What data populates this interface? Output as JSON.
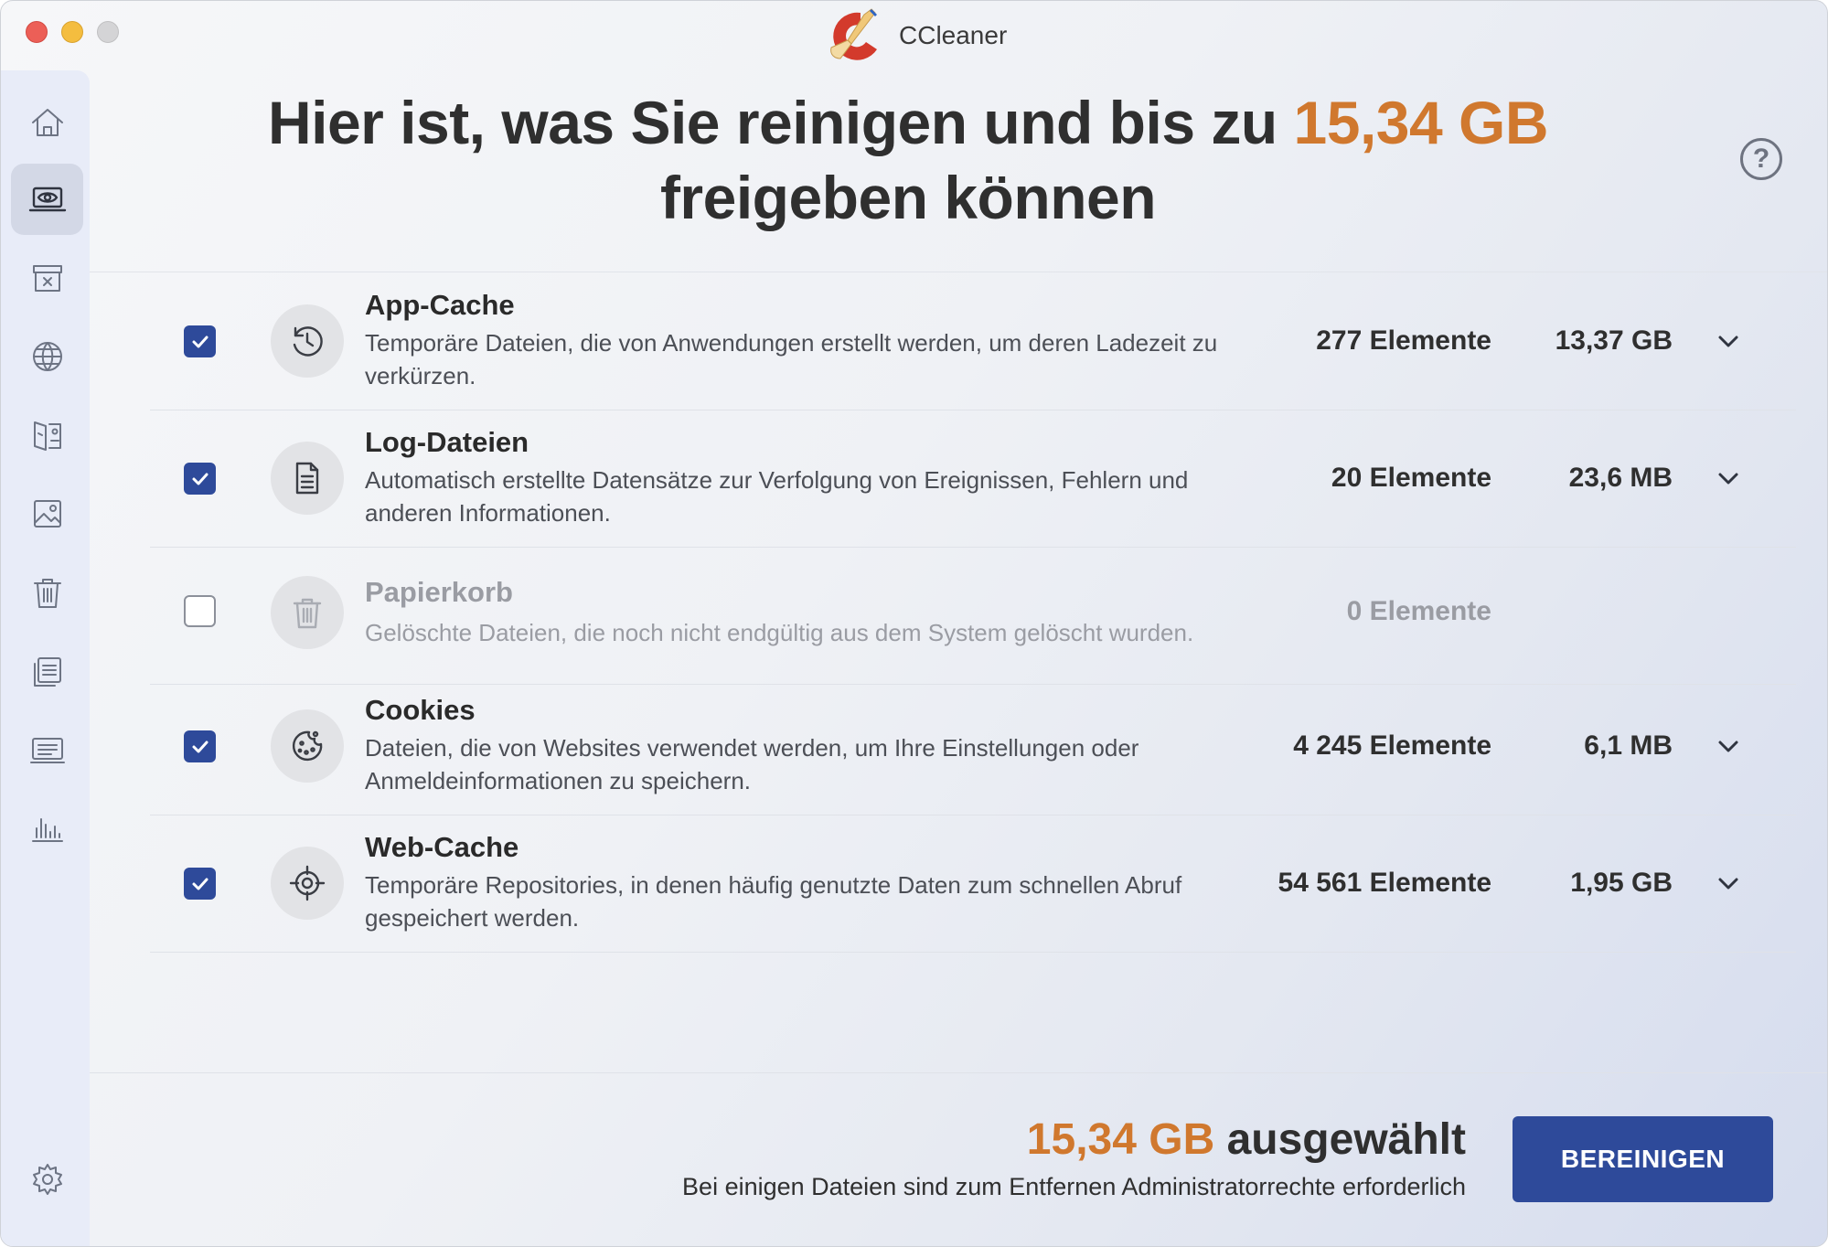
{
  "window": {
    "app_name": "CCleaner"
  },
  "sidebar": {
    "items": [
      {
        "icon": "home-icon"
      },
      {
        "icon": "laptop-eye-icon",
        "active": true
      },
      {
        "icon": "archive-box-icon"
      },
      {
        "icon": "globe-icon"
      },
      {
        "icon": "app-uninstall-icon"
      },
      {
        "icon": "image-icon"
      },
      {
        "icon": "trash-icon"
      },
      {
        "icon": "list-edit-icon"
      },
      {
        "icon": "keyboard-icon"
      },
      {
        "icon": "bar-chart-icon"
      }
    ],
    "settings_icon": "gear-icon"
  },
  "header": {
    "title_prefix": "Hier ist, was Sie reinigen und bis zu",
    "title_amount": "15,34 GB",
    "title_suffix": "freigeben können",
    "help_label": "?"
  },
  "categories": [
    {
      "title": "App-Cache",
      "description": "Temporäre Dateien, die von Anwendungen erstellt werden, um deren Ladezeit zu verkürzen.",
      "count": "277 Elemente",
      "size": "13,37 GB",
      "checked": true,
      "icon": "history-clock-icon"
    },
    {
      "title": "Log-Dateien",
      "description": "Automatisch erstellte Datensätze zur Verfolgung von Ereignissen, Fehlern und anderen Informationen.",
      "count": "20 Elemente",
      "size": "23,6 MB",
      "checked": true,
      "icon": "document-icon"
    },
    {
      "title": "Papierkorb",
      "description": "Gelöschte Dateien, die noch nicht endgültig aus dem System gelöscht wurden.",
      "count": "0 Elemente",
      "size": "",
      "checked": false,
      "icon": "trash-icon"
    },
    {
      "title": "Cookies",
      "description": "Dateien, die von Websites verwendet werden, um Ihre Einstellungen oder Anmeldeinformationen zu speichern.",
      "count": "4 245 Elemente",
      "size": "6,1 MB",
      "checked": true,
      "icon": "cookie-icon"
    },
    {
      "title": "Web-Cache",
      "description": "Temporäre Repositories, in denen häufig genutzte Daten zum schnellen Abruf gespeichert werden.",
      "count": "54 561 Elemente",
      "size": "1,95 GB",
      "checked": true,
      "icon": "crosshair-icon"
    }
  ],
  "footer": {
    "selected_amount": "15,34 GB",
    "selected_label": "ausgewählt",
    "admin_note": "Bei einigen Dateien sind zum Entfernen Administratorrechte erforderlich",
    "clean_button": "BEREINIGEN"
  },
  "colors": {
    "accent": "#d0782e",
    "primary": "#2e4a9a"
  }
}
